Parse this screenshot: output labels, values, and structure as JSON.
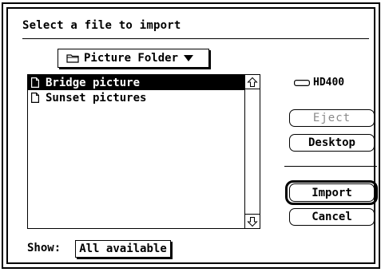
{
  "dialog": {
    "title": "Select a file to import"
  },
  "folder_popup": {
    "label": "Picture Folder",
    "icon": "folder-icon",
    "arrow": "triangle-down-icon"
  },
  "file_list": {
    "items": [
      {
        "label": "Bridge picture",
        "icon": "document-icon",
        "selected": true
      },
      {
        "label": "Sunset pictures",
        "icon": "document-icon",
        "selected": false
      }
    ],
    "scroll_up_icon": "arrow-up-icon",
    "scroll_down_icon": "arrow-down-icon"
  },
  "volume": {
    "label": "HD400",
    "icon": "hard-disk-icon"
  },
  "buttons": {
    "eject": "Eject",
    "desktop": "Desktop",
    "import": "Import",
    "cancel": "Cancel"
  },
  "show": {
    "label": "Show:",
    "value": "All available"
  },
  "colors": {
    "foreground": "#000000",
    "background": "#ffffff",
    "disabled_text": "#8a8a8a"
  }
}
